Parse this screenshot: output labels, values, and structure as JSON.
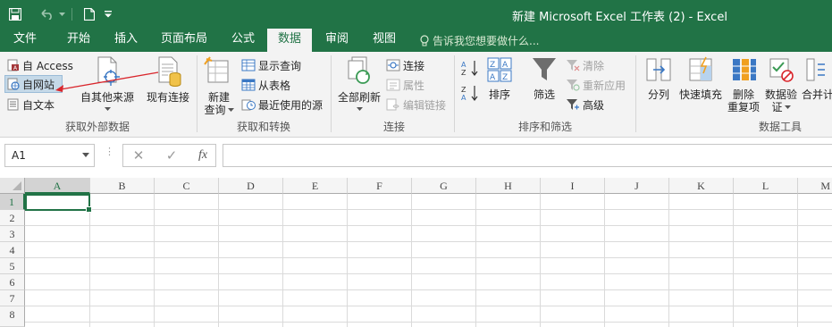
{
  "window": {
    "title": "新建 Microsoft Excel 工作表 (2) - Excel"
  },
  "tabs": [
    {
      "id": "file",
      "label": "文件"
    },
    {
      "id": "home",
      "label": "开始"
    },
    {
      "id": "insert",
      "label": "插入"
    },
    {
      "id": "layout",
      "label": "页面布局"
    },
    {
      "id": "formulas",
      "label": "公式"
    },
    {
      "id": "data",
      "label": "数据",
      "active": true
    },
    {
      "id": "review",
      "label": "审阅"
    },
    {
      "id": "view",
      "label": "视图"
    }
  ],
  "tell_me": "告诉我您想要做什么...",
  "ribbon": {
    "get_external": {
      "label": "获取外部数据",
      "from_access": "自 Access",
      "from_web": "自网站",
      "from_text": "自文本",
      "from_other": "自其他来源",
      "existing": "现有连接"
    },
    "get_transform": {
      "label": "获取和转换",
      "new_query_1": "新建",
      "new_query_2": "查询",
      "show_queries": "显示查询",
      "from_table": "从表格",
      "recent_sources": "最近使用的源"
    },
    "connections": {
      "label": "连接",
      "refresh_all": "全部刷新",
      "connections": "连接",
      "properties": "属性",
      "edit_links": "编辑链接"
    },
    "sort_filter": {
      "label": "排序和筛选",
      "sort": "排序",
      "filter": "筛选",
      "clear": "清除",
      "reapply": "重新应用",
      "advanced": "高级"
    },
    "data_tools": {
      "label": "数据工具",
      "split": "分列",
      "flash_fill": "快速填充",
      "remove_dup_1": "删除",
      "remove_dup_2": "重复项",
      "validation_1": "数据验",
      "validation_2": "证",
      "consolidate": "合并计"
    }
  },
  "formula_bar": {
    "name_box": "A1",
    "cancel": "✕",
    "enter": "✓",
    "fx": "fx",
    "value": ""
  },
  "sheet": {
    "columns": [
      "A",
      "B",
      "C",
      "D",
      "E",
      "F",
      "G",
      "H",
      "I",
      "J",
      "K",
      "L",
      "M"
    ],
    "rows": [
      "1",
      "2",
      "3",
      "4",
      "5",
      "6",
      "7",
      "8"
    ],
    "active_cell": "A1"
  },
  "colors": {
    "brand": "#217346",
    "ribbon_bg": "#f3f3f3",
    "annotation_arrow": "#d9262c"
  }
}
